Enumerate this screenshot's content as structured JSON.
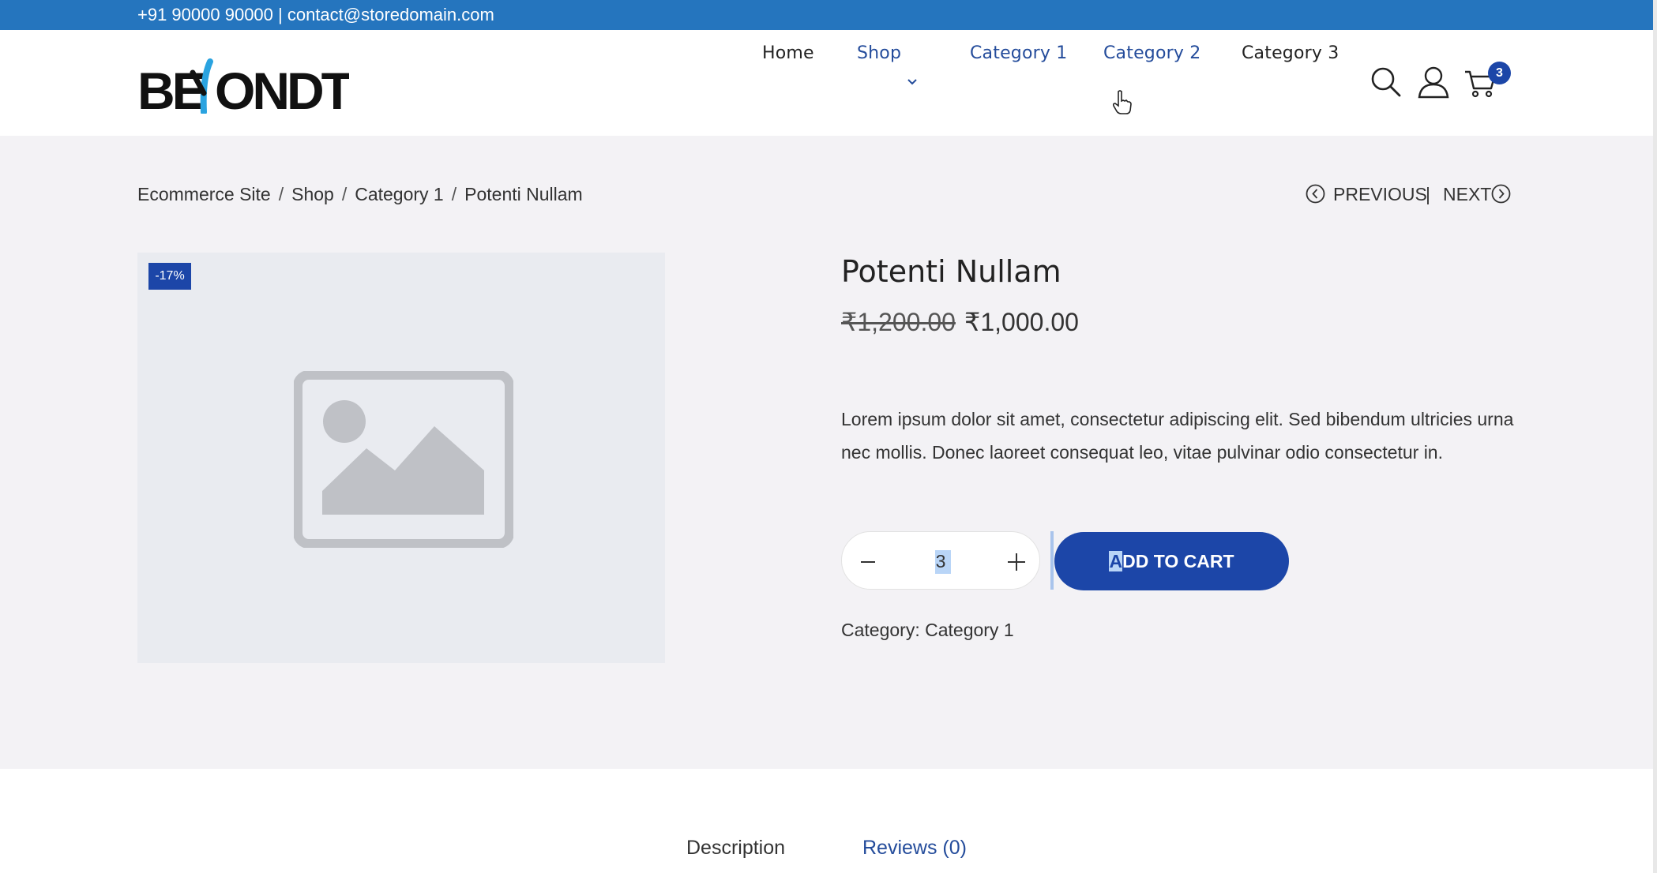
{
  "topbar": {
    "contact": "+91 90000 90000 | contact@storedomain.com",
    "bg_color": "#2575be"
  },
  "logo": {
    "alt": "BEYONDT",
    "icon": "beyondt-logo"
  },
  "nav": {
    "items": [
      {
        "label": "Home"
      },
      {
        "label": "Shop",
        "has_dropdown": true
      },
      {
        "label": "Category 1"
      },
      {
        "label": "Category 2"
      },
      {
        "label": "Category 3"
      }
    ],
    "icons": [
      "search-icon",
      "user-icon",
      "cart-icon"
    ],
    "cart_count": "3"
  },
  "breadcrumb": [
    "Ecommerce Site",
    "Shop",
    "Category 1",
    "Potenti Nullam"
  ],
  "pager": {
    "previous": "PREVIOUS",
    "separator": "|",
    "next": "NEXT"
  },
  "product": {
    "image_icon": "image-placeholder-icon",
    "badge": "-17%",
    "title": "Potenti Nullam",
    "old_price": "₹1,200.00",
    "price": "₹1,000.00",
    "description": "Lorem ipsum dolor sit amet, consectetur adipiscing elit. Sed bibendum ultricies urna nec mollis. Donec laoreet consequat leo, vitae pulvinar odio consectetur in.",
    "quantity": "3",
    "add_to_cart_first": "A",
    "add_to_cart_rest": "DD TO CART",
    "category_label": "Category:",
    "category_value": "Category 1"
  },
  "tabs": [
    {
      "label": "Description"
    },
    {
      "label": "Reviews (0)"
    }
  ],
  "colors": {
    "accent": "#1c46a8",
    "link": "#244c9b",
    "page_bg": "#f3f2f5",
    "image_bg": "#e9ebf0"
  }
}
